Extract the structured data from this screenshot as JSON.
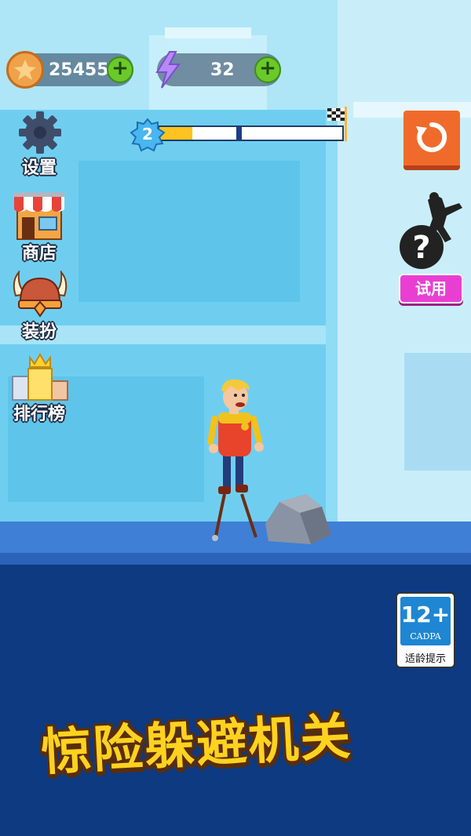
{
  "hud": {
    "coins": "25455",
    "energy": "32",
    "level": "2",
    "progress": 0.18,
    "marker": 0.42
  },
  "menu": {
    "settings": "设置",
    "shop": "商店",
    "dressup": "装扮",
    "leaderboard": "排行榜"
  },
  "trial": {
    "label": "试用"
  },
  "age_rating": {
    "age": "12+",
    "org": "CADPA",
    "note": "适龄提示"
  },
  "slogan": "惊险躲避机关",
  "colors": {
    "sky": "#8fdcf5",
    "ground": "#0d3a80",
    "restart": "#f06b2b",
    "trial": "#e83fd2"
  }
}
